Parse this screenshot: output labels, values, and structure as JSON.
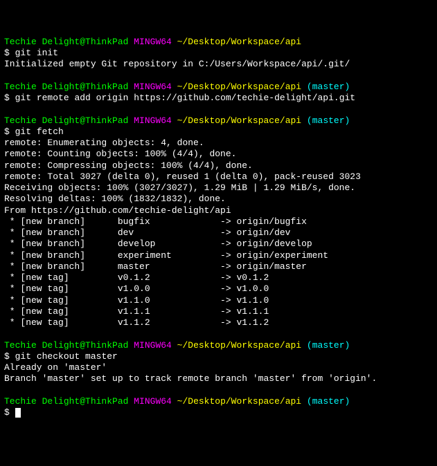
{
  "prompt": {
    "user": "Techie Delight@ThinkPad",
    "host": "MINGW64",
    "path": "~/Desktop/Workspace/api",
    "branch": "(master)",
    "symbol": "$"
  },
  "block1": {
    "cmd": "git init",
    "out1": "Initialized empty Git repository in C:/Users/Workspace/api/.git/"
  },
  "block2": {
    "cmd": "git remote add origin https://github.com/techie-delight/api.git"
  },
  "block3": {
    "cmd": "git fetch",
    "out1": "remote: Enumerating objects: 4, done.",
    "out2": "remote: Counting objects: 100% (4/4), done.",
    "out3": "remote: Compressing objects: 100% (4/4), done.",
    "out4": "remote: Total 3027 (delta 0), reused 1 (delta 0), pack-reused 3023",
    "out5": "Receiving objects: 100% (3027/3027), 1.29 MiB | 1.29 MiB/s, done.",
    "out6": "Resolving deltas: 100% (1832/1832), done.",
    "out7": "From https://github.com/techie-delight/api",
    "r1": " * [new branch]      bugfix             -> origin/bugfix",
    "r2": " * [new branch]      dev                -> origin/dev",
    "r3": " * [new branch]      develop            -> origin/develop",
    "r4": " * [new branch]      experiment         -> origin/experiment",
    "r5": " * [new branch]      master             -> origin/master",
    "r6": " * [new tag]         v0.1.2             -> v0.1.2",
    "r7": " * [new tag]         v1.0.0             -> v1.0.0",
    "r8": " * [new tag]         v1.1.0             -> v1.1.0",
    "r9": " * [new tag]         v1.1.1             -> v1.1.1",
    "r10": " * [new tag]         v1.1.2             -> v1.1.2"
  },
  "block4": {
    "cmd": "git checkout master",
    "out1": "Already on 'master'",
    "out2": "Branch 'master' set up to track remote branch 'master' from 'origin'."
  }
}
